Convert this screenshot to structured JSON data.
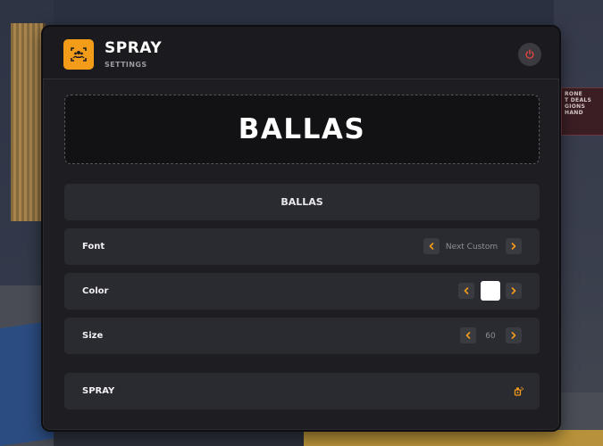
{
  "header": {
    "title": "SPRAY",
    "subtitle": "SETTINGS"
  },
  "background_sign": {
    "lines": [
      "RONE",
      "T DEALS",
      "GIONS",
      "HAND"
    ]
  },
  "preview": {
    "text": "BALLAS"
  },
  "text_input": {
    "value": "BALLAS"
  },
  "settings": {
    "font": {
      "label": "Font",
      "value": "Next Custom"
    },
    "color": {
      "label": "Color",
      "value": "#ffffff"
    },
    "size": {
      "label": "Size",
      "value": "60"
    }
  },
  "action": {
    "label": "SPRAY"
  },
  "colors": {
    "accent": "#f39c1a",
    "power": "#e0463e",
    "panel_bg": "#1d1d22",
    "row_bg": "#2a2a31"
  },
  "icons": {
    "app": "spray-can-icon",
    "power": "power-icon",
    "prev": "chevron-left-icon",
    "next": "chevron-right-icon",
    "action": "spray-can-icon"
  }
}
